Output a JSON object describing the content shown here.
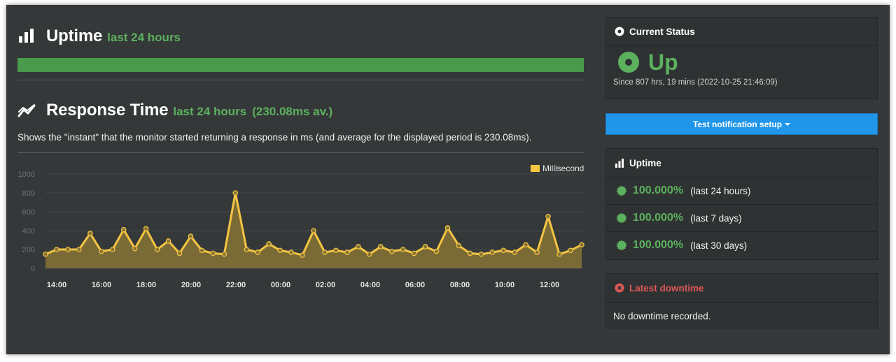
{
  "uptime_header": {
    "title": "Uptime",
    "subtitle": "last 24 hours"
  },
  "response_header": {
    "title": "Response Time",
    "subtitle": "last 24 hours",
    "average": "(230.08ms av.)"
  },
  "response_description": "Shows the \"instant\" that the monitor started returning a response in ms (and average for the displayed period is 230.08ms).",
  "colors": {
    "accent_green": "#5cb15f",
    "bar_green": "#4a9a4c",
    "series_gold": "#f4c542",
    "area_fill": "#7a6a36",
    "button_blue": "#2196e9",
    "downtime_red": "#e05858",
    "panel_bg": "#2f3233",
    "page_bg": "#353839"
  },
  "chart_data": {
    "type": "area",
    "legend": "Milliseconds",
    "legend_position": "top-right",
    "ylim": [
      0,
      1000
    ],
    "yticks": [
      "0",
      "200",
      "400",
      "600",
      "800",
      "1000"
    ],
    "xticks": [
      "14:00",
      "16:00",
      "18:00",
      "20:00",
      "22:00",
      "00:00",
      "02:00",
      "04:00",
      "06:00",
      "08:00",
      "10:00",
      "12:00"
    ],
    "grid": true,
    "series": [
      {
        "name": "Milliseconds",
        "values": [
          150,
          200,
          200,
          200,
          370,
          180,
          200,
          410,
          210,
          420,
          200,
          290,
          160,
          340,
          190,
          160,
          150,
          800,
          200,
          170,
          260,
          190,
          170,
          140,
          400,
          170,
          190,
          170,
          230,
          150,
          230,
          180,
          200,
          160,
          230,
          180,
          430,
          240,
          160,
          150,
          170,
          190,
          170,
          250,
          170,
          550,
          150,
          190,
          250
        ]
      }
    ]
  },
  "current_status": {
    "title": "Current Status",
    "state": "Up",
    "since": "Since 807 hrs, 19 mins (2022-10-25 21:46:09)"
  },
  "test_button": {
    "label": "Test notification setup"
  },
  "uptime_panel": {
    "title": "Uptime",
    "rows": [
      {
        "pct": "100.000%",
        "period": "(last 24 hours)"
      },
      {
        "pct": "100.000%",
        "period": "(last 7 days)"
      },
      {
        "pct": "100.000%",
        "period": "(last 30 days)"
      }
    ]
  },
  "downtime_panel": {
    "title": "Latest downtime",
    "message": "No downtime recorded."
  }
}
